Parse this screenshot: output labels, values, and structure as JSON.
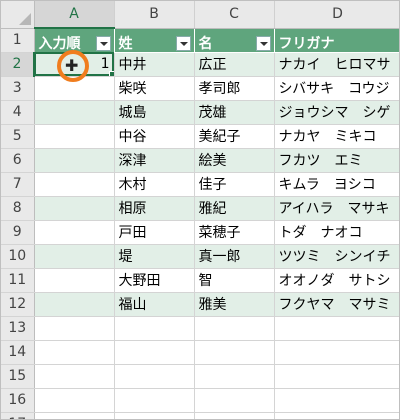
{
  "columns": [
    "A",
    "B",
    "C",
    "D"
  ],
  "headers": [
    "入力順",
    "姓",
    "名",
    "フリガナ"
  ],
  "rows": [
    {
      "num": "2",
      "order": "1",
      "last": "中井",
      "first": "広正",
      "kana": "ナカイ　ヒロマサ"
    },
    {
      "num": "3",
      "order": "",
      "last": "柴咲",
      "first": "孝司郎",
      "kana": "シバサキ　コウジ"
    },
    {
      "num": "4",
      "order": "",
      "last": "城島",
      "first": "茂雄",
      "kana": "ジョウシマ　シゲ"
    },
    {
      "num": "5",
      "order": "",
      "last": "中谷",
      "first": "美紀子",
      "kana": "ナカヤ　ミキコ"
    },
    {
      "num": "6",
      "order": "",
      "last": "深津",
      "first": "絵美",
      "kana": "フカツ　エミ"
    },
    {
      "num": "7",
      "order": "",
      "last": "木村",
      "first": "佳子",
      "kana": "キムラ　ヨシコ"
    },
    {
      "num": "8",
      "order": "",
      "last": "相原",
      "first": "雅紀",
      "kana": "アイハラ　マサキ"
    },
    {
      "num": "9",
      "order": "",
      "last": "戸田",
      "first": "菜穂子",
      "kana": "トダ　ナオコ"
    },
    {
      "num": "10",
      "order": "",
      "last": "堤",
      "first": "真一郎",
      "kana": "ツツミ　シンイチ"
    },
    {
      "num": "11",
      "order": "",
      "last": "大野田",
      "first": "智",
      "kana": "オオノダ　サトシ"
    },
    {
      "num": "12",
      "order": "",
      "last": "福山",
      "first": "雅美",
      "kana": "フクヤマ　マサミ"
    }
  ],
  "empty_rows": [
    "13",
    "14",
    "15",
    "16",
    "17"
  ],
  "header_row_num": "1",
  "cursor_glyph": "✚",
  "colors": {
    "table_header": "#5fa57d",
    "band": "#e2efe7",
    "accent": "#217346",
    "highlight_ring": "#f07d1e"
  }
}
